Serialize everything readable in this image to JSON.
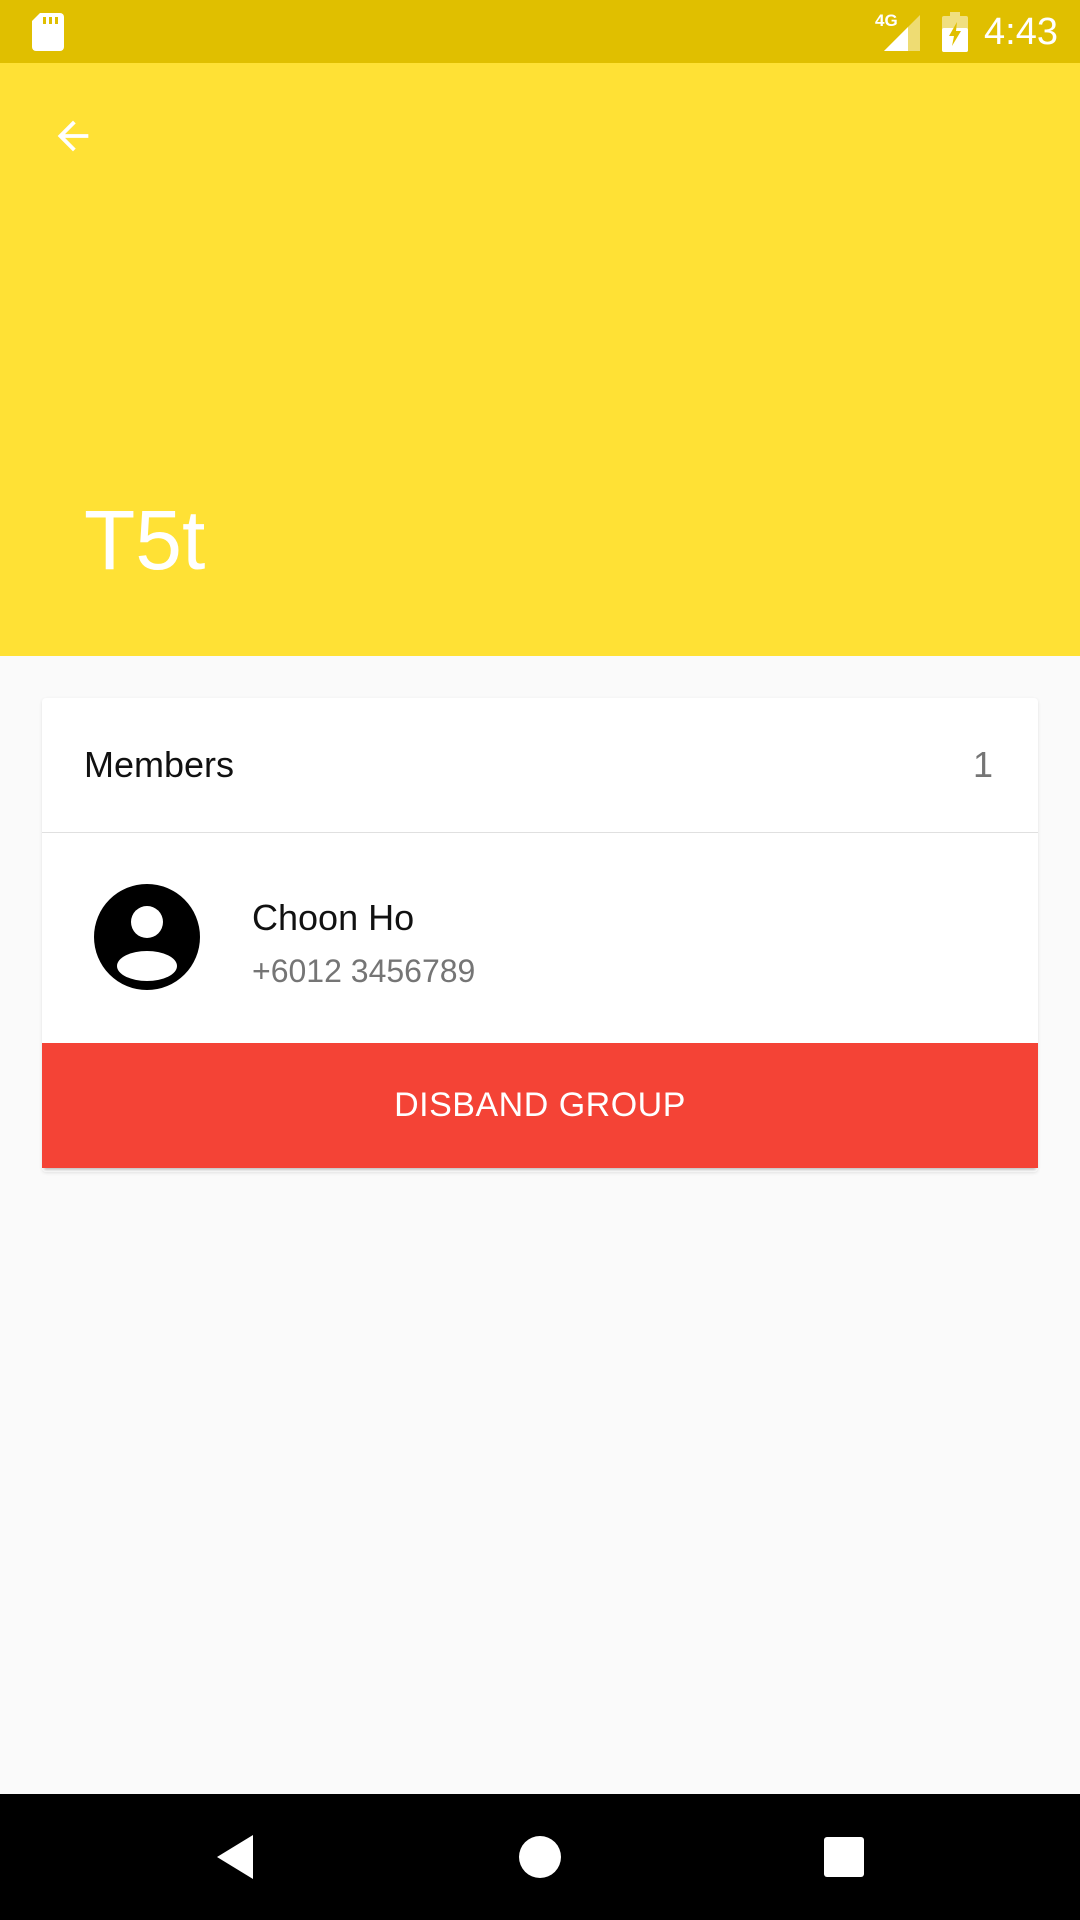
{
  "status_bar": {
    "network": "4G",
    "time": "4:43",
    "icons": [
      "sd-card-icon",
      "signal-icon",
      "battery-charging-icon"
    ]
  },
  "header": {
    "back_icon": "arrow-back-icon",
    "group_name": "T5t",
    "color": "#ffe135"
  },
  "members_section": {
    "label": "Members",
    "count": "1",
    "members": [
      {
        "name": "Choon Ho",
        "phone": "+6012 3456789",
        "avatar_icon": "account-circle-icon"
      }
    ]
  },
  "actions": {
    "disband_label": "DISBAND GROUP",
    "disband_color": "#f44336"
  },
  "nav_bar": {
    "icons": [
      "nav-back-icon",
      "nav-home-icon",
      "nav-recents-icon"
    ]
  }
}
